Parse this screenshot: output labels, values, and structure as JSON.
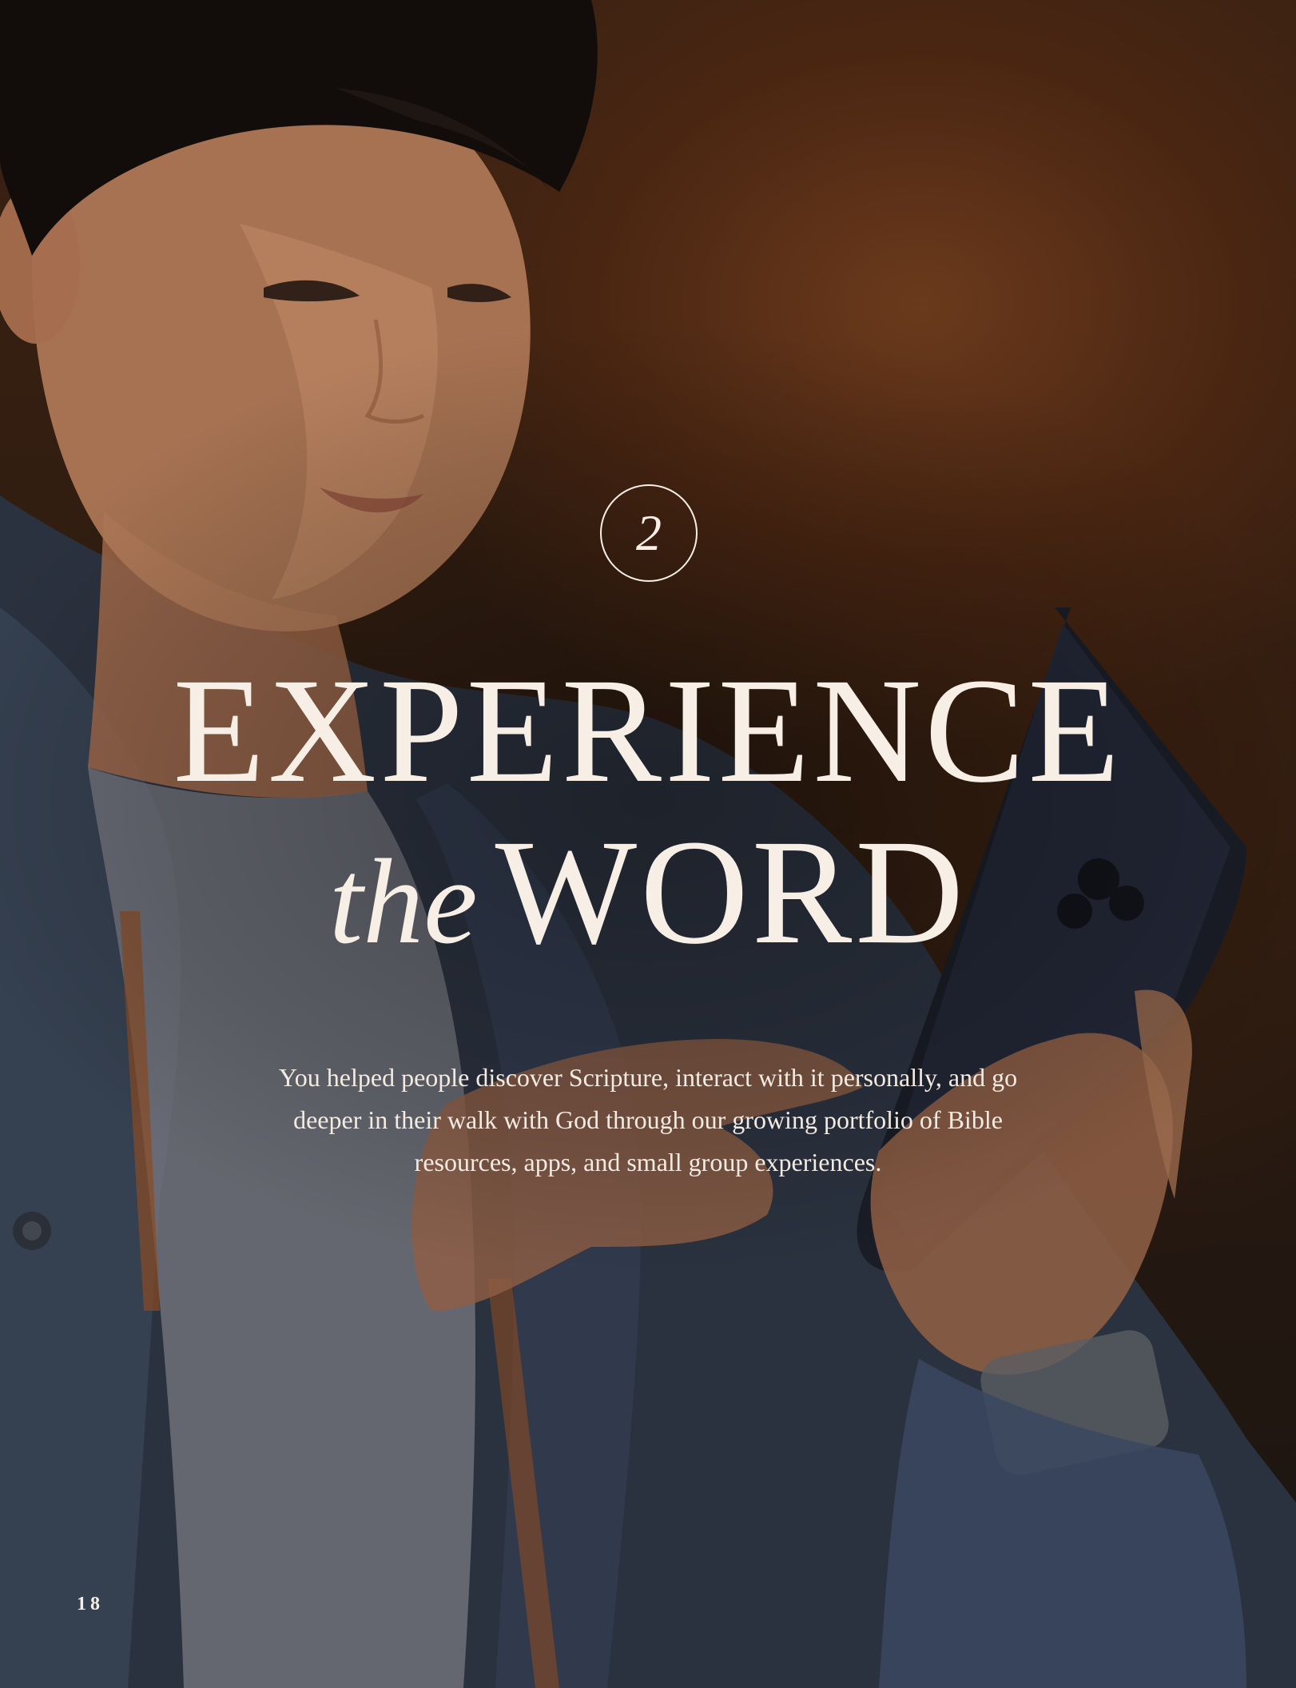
{
  "chapter": {
    "number": "2"
  },
  "title": {
    "line1": "EXPERIENCE",
    "line2_italic": "the",
    "line2_main": "WORD"
  },
  "intro_text": "You helped people discover Scripture, interact with it personally, and go deeper in their walk with God through our growing portfolio of Bible resources, apps, and small group experiences.",
  "page_number": "18",
  "colors": {
    "text": "#f7efe6",
    "background_warm": "#6b3a1c",
    "background_dark": "#1c1410"
  }
}
